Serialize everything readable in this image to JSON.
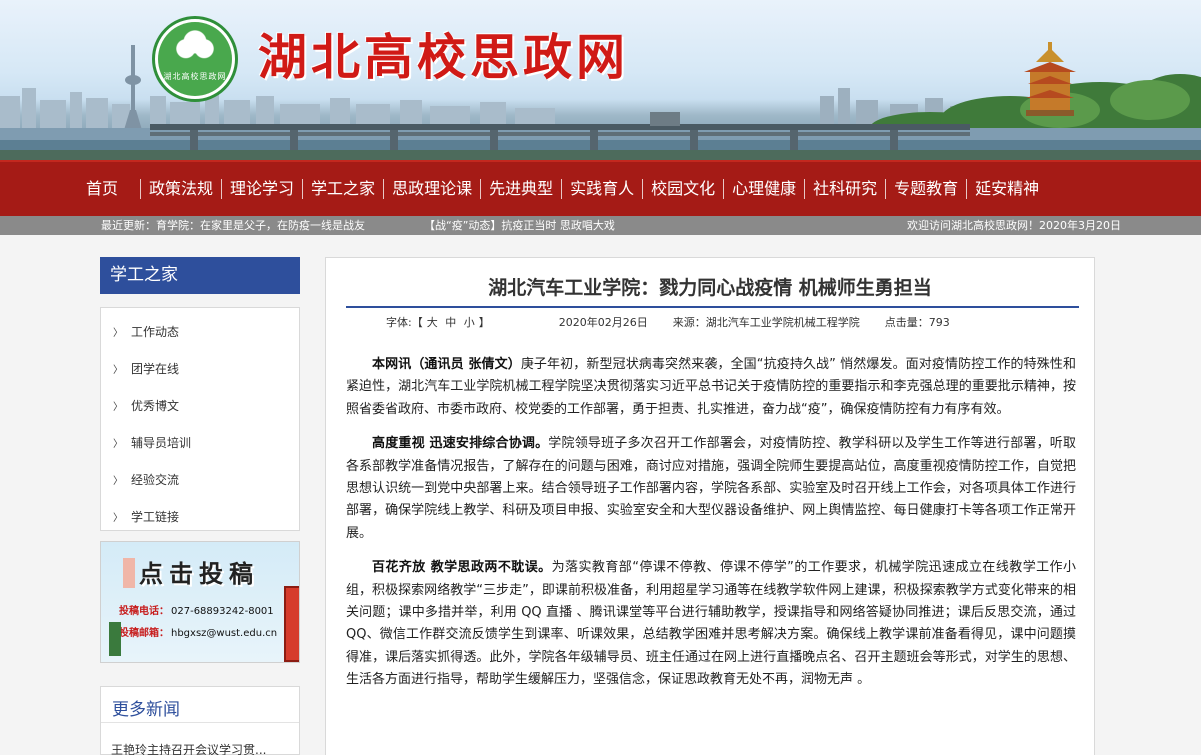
{
  "site": {
    "title": "湖北高校思政网",
    "logo_text": "湖北高校思政网"
  },
  "nav": {
    "items": [
      "首页",
      "政策法规",
      "理论学习",
      "学工之家",
      "思政理论课",
      "先进典型",
      "实践育人",
      "校园文化",
      "心理健康",
      "社科研究",
      "专题教育",
      "延安精神"
    ]
  },
  "ticker": {
    "left": "最近更新：育学院：在家里是父子，在防疫一线是战友",
    "middle": "【战“疫”动态】抗疫正当时 思政唱大戏",
    "right": "欢迎访问湖北高校思政网！2020年3月20日"
  },
  "sidebar": {
    "title": "学工之家",
    "items": [
      "工作动态",
      "团学在线",
      "优秀博文",
      "辅导员培训",
      "经验交流",
      "学工链接"
    ],
    "arrow": "〉"
  },
  "promo": {
    "title": "点击投稿",
    "phone_label": "投稿电话：",
    "phone": "027-68893242-8001",
    "email_label": "投稿邮箱：",
    "email": "hbgxsz@wust.edu.cn"
  },
  "more_news": {
    "title": "更多新闻",
    "items": [
      "王艳玲主持召开会议学习贯..."
    ]
  },
  "article": {
    "title": "湖北汽车工业学院：戮力同心战疫情 机械师生勇担当",
    "font_label": "字体:【",
    "font_large": "大",
    "font_medium": "中",
    "font_small": "小",
    "font_close": "】",
    "date": "2020年02月26日",
    "source": "来源：湖北汽车工业学院机械工程学院",
    "hits": "点击量：793",
    "paragraphs": [
      {
        "lead": "本网讯（通讯员 张倩文）",
        "text": "庚子年初，新型冠状病毒突然来袭，全国“抗疫持久战” 悄然爆发。面对疫情防控工作的特殊性和紧迫性，湖北汽车工业学院机械工程学院坚决贯彻落实习近平总书记关于疫情防控的重要指示和李克强总理的重要批示精神，按照省委省政府、市委市政府、校党委的工作部署，勇于担责、扎实推进，奋力战“疫”，确保疫情防控有力有序有效。"
      },
      {
        "lead": "高度重视 迅速安排综合协调。",
        "text": "学院领导班子多次召开工作部署会，对疫情防控、教学科研以及学生工作等进行部署，听取各系部教学准备情况报告，了解存在的问题与困难，商讨应对措施，强调全院师生要提高站位，高度重视疫情防控工作，自觉把思想认识统一到党中央部署上来。结合领导班子工作部署内容，学院各系部、实验室及时召开线上工作会，对各项具体工作进行部署，确保学院线上教学、科研及项目申报、实验室安全和大型仪器设备维护、网上舆情监控、每日健康打卡等各项工作正常开展。"
      },
      {
        "lead": "百花齐放 教学思政两不耽误。",
        "text": "为落实教育部“停课不停教、停课不停学”的工作要求，机械学院迅速成立在线教学工作小组，积极探索网络教学“三步走”，即课前积极准备，利用超星学习通等在线教学软件网上建课，积极探索教学方式变化带来的相关问题；课中多措并举，利用 QQ 直播 、腾讯课堂等平台进行辅助教学，授课指导和网络答疑协同推进；课后反思交流，通过QQ、微信工作群交流反馈学生到课率、听课效果，总结教学困难并思考解决方案。确保线上教学课前准备看得见，课中问题摸得准，课后落实抓得透。此外，学院各年级辅导员、班主任通过在网上进行直播晚点名、召开主题班会等形式，对学生的思想、生活各方面进行指导，帮助学生缓解压力，坚强信念，保证思政教育无处不再，润物无声 。"
      }
    ]
  },
  "colors": {
    "nav_bg": "#a51b16",
    "title_red": "#d01a16",
    "sidebar_blue": "#2e4f9c",
    "ticker_bg": "#8a8a8a"
  }
}
